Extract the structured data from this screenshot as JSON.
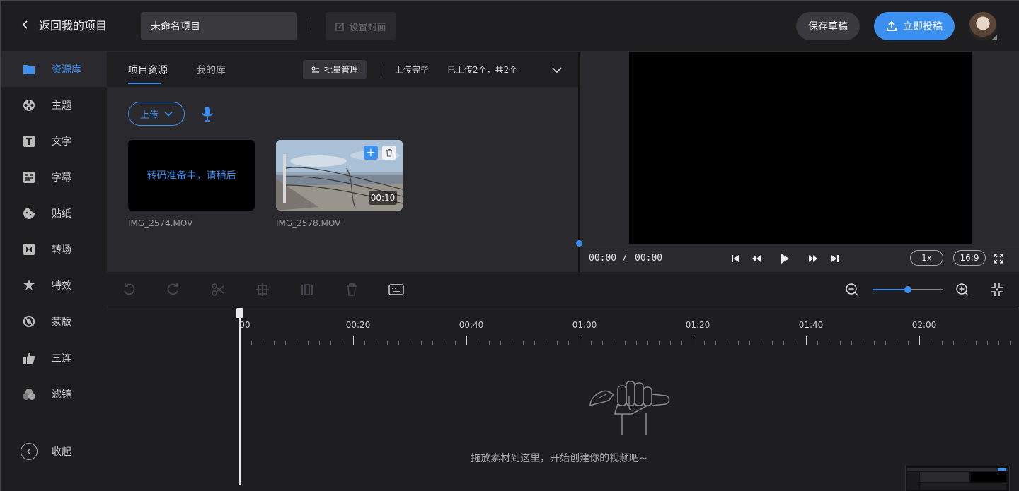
{
  "topbar": {
    "back_label": "返回我的项目",
    "project_title": "未命名项目",
    "cover_label": "设置封面",
    "save_label": "保存草稿",
    "publish_label": "立即投稿"
  },
  "sidebar": {
    "items": [
      {
        "label": "资源库",
        "icon": "folder-icon",
        "active": true
      },
      {
        "label": "主题",
        "icon": "film-reel-icon",
        "active": false
      },
      {
        "label": "文字",
        "icon": "text-icon",
        "active": false
      },
      {
        "label": "字幕",
        "icon": "subtitle-icon",
        "active": false
      },
      {
        "label": "贴纸",
        "icon": "sticker-icon",
        "active": false
      },
      {
        "label": "转场",
        "icon": "transition-icon",
        "active": false
      },
      {
        "label": "特效",
        "icon": "effects-icon",
        "active": false
      },
      {
        "label": "蒙版",
        "icon": "mask-icon",
        "active": false
      },
      {
        "label": "三连",
        "icon": "thumbs-up-icon",
        "active": false
      },
      {
        "label": "滤镜",
        "icon": "filter-icon",
        "active": false
      }
    ],
    "collapse_label": "收起"
  },
  "resources": {
    "tabs": [
      "项目资源",
      "我的库"
    ],
    "batch_label": "批量管理",
    "upload_status": "上传完毕",
    "upload_count": "已上传2个，共2个",
    "upload_button": "上传",
    "cards": [
      {
        "name": "IMG_2574.MOV",
        "overlay_text": "转码准备中，请稍后"
      },
      {
        "name": "IMG_2578.MOV",
        "duration": "00:10"
      }
    ]
  },
  "preview": {
    "current_time": "00:00",
    "divider": "/",
    "total_time": "00:00",
    "speed": "1x",
    "ratio": "16:9"
  },
  "timeline": {
    "ticks": [
      "00",
      "00:20",
      "00:40",
      "01:00",
      "01:20",
      "01:40",
      "02:00"
    ],
    "empty_hint": "拖放素材到这里，开始创建你的视频吧~",
    "zoom_level": 0.5
  },
  "colors": {
    "accent": "#3b8ff0",
    "background": "#1e1e21",
    "panel": "#2a2a2e"
  }
}
